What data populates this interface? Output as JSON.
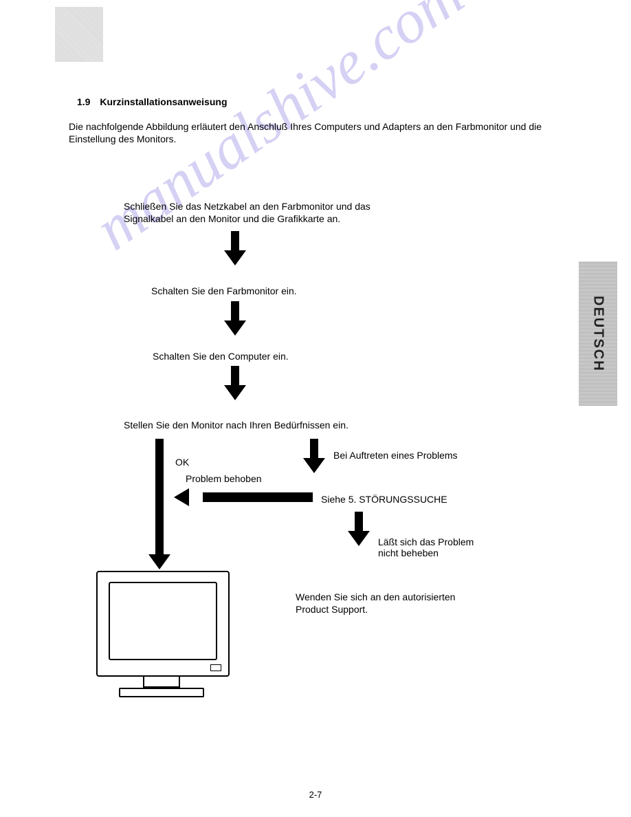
{
  "heading": {
    "number": "1.9",
    "title": "Kurzinstallationsanweisung"
  },
  "intro": "Die nachfolgende Abbildung erläutert den Anschluß Ihres Computers und Adapters an den Farbmonitor und die Einstellung des Monitors.",
  "steps": {
    "s1": "Schließen Sie das Netzkabel an den Farbmonitor und das Signalkabel an den Monitor und die Grafikkarte an.",
    "s2": "Schalten Sie den Farbmonitor ein.",
    "s3": "Schalten Sie den Computer ein.",
    "s4": "Stellen Sie den Monitor nach Ihren Bedürfnissen ein.",
    "s5": "Siehe 5. STÖRUNGSSUCHE",
    "s6": "Wenden Sie sich an den autorisierten Product Support."
  },
  "labels": {
    "ok": "OK",
    "problem": "Bei Auftreten eines Problems",
    "resolved": "Problem behoben",
    "unresolved": "Läßt sich das Problem nicht beheben"
  },
  "sideTab": "DEUTSCH",
  "pageNumber": "2-7",
  "watermark": "manualshive.com"
}
